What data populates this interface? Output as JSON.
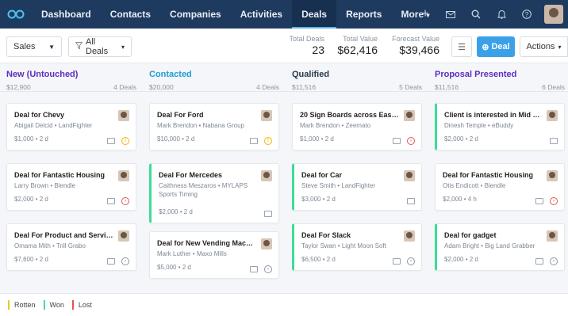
{
  "nav": {
    "items": [
      "Dashboard",
      "Contacts",
      "Companies",
      "Activities",
      "Deals",
      "Reports",
      "More"
    ],
    "active": "Deals",
    "icons": [
      "plus-icon",
      "mail-icon",
      "search-icon",
      "bell-icon",
      "help-icon"
    ]
  },
  "toolbar": {
    "pipeline": "Sales",
    "filter": "All Deals",
    "total_deals_label": "Total Deals",
    "total_deals": "23",
    "total_value_label": "Total Value",
    "total_value": "$62,416",
    "forecast_label": "Forecast Value",
    "forecast": "$39,466",
    "deal_button": "Deal",
    "actions": "Actions"
  },
  "columns": [
    {
      "title": "New (Untouched)",
      "color": "#5b2ec2",
      "amount": "$12,900",
      "count": "4 Deals",
      "cards": [
        {
          "title": "Deal for Chevy",
          "person": "Abigail Delcid",
          "company": "LandFighter",
          "value": "$1,000",
          "age": "2 d",
          "status": "rotten",
          "accent": ""
        },
        {
          "title": "Deal for Fantastic Housing",
          "person": "Larry Brown",
          "company": "Blendle",
          "value": "$2,000",
          "age": "2 d",
          "status": "lost",
          "accent": ""
        },
        {
          "title": "Deal For Product and Services",
          "person": "Omama Mith",
          "company": "Trill Grabo",
          "value": "$7,600",
          "age": "2 d",
          "status": "open",
          "accent": ""
        }
      ]
    },
    {
      "title": "Contacted",
      "color": "#1a9ed8",
      "amount": "$20,000",
      "count": "4 Deals",
      "cards": [
        {
          "title": "Deal For Ford",
          "person": "Mark Brendon",
          "company": "Nabana Group",
          "value": "$10,000",
          "age": "2 d",
          "status": "rotten",
          "accent": ""
        },
        {
          "title": "Deal For Mercedes",
          "person": "Caithness Meszaros",
          "company": "MYLAPS Sports Timing",
          "value": "$2,000",
          "age": "2 d",
          "status": "",
          "accent": "won"
        },
        {
          "title": "Deal for New Vending Machine",
          "person": "Mark Luther",
          "company": "Maxo Mills",
          "value": "$5,000",
          "age": "2 d",
          "status": "open",
          "accent": ""
        }
      ]
    },
    {
      "title": "Qualified",
      "color": "#2b3a4e",
      "amount": "$11,516",
      "count": "5 Deals",
      "cards": [
        {
          "title": "20 Sign Boards across East Str...",
          "person": "Mark Brendon",
          "company": "Zeemato",
          "value": "$1,000",
          "age": "2 d",
          "status": "lost",
          "accent": ""
        },
        {
          "title": "Deal for Car",
          "person": "Steve Smith",
          "company": "LandFighter",
          "value": "$3,000",
          "age": "2 d",
          "status": "",
          "accent": "won"
        },
        {
          "title": "Deal For Slack",
          "person": "Taylor Swan",
          "company": "Light Moon Soft",
          "value": "$6,500",
          "age": "2 d",
          "status": "open",
          "accent": "won"
        }
      ]
    },
    {
      "title": "Proposal Presented",
      "color": "#5b2ec2",
      "amount": "$11,516",
      "count": "6 Deals",
      "cards": [
        {
          "title": "Client is interested in Mid Lev...",
          "person": "Dinesh Temple",
          "company": "eBuddy",
          "value": "$2,000",
          "age": "2 d",
          "status": "",
          "accent": "won"
        },
        {
          "title": "Deal for Fantastic Housing",
          "person": "Otis Endicott",
          "company": "Blendle",
          "value": "$2,000",
          "age": "4 h",
          "status": "lost",
          "accent": ""
        },
        {
          "title": "Deal for gadget",
          "person": "Adam Bright",
          "company": "Big Land Grabber",
          "value": "$2,000",
          "age": "2 d",
          "status": "open",
          "accent": "won"
        }
      ]
    }
  ],
  "legend": [
    {
      "label": "Rotten",
      "color": "#f2c12e"
    },
    {
      "label": "Won",
      "color": "#3ddc97"
    },
    {
      "label": "Lost",
      "color": "#e05555"
    }
  ]
}
